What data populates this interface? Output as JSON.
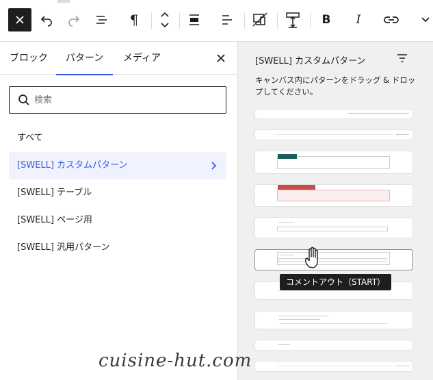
{
  "toolbar": {
    "close_icon": "close-icon",
    "undo_icon": "undo-icon",
    "redo_icon": "redo-icon",
    "list_view_icon": "list-view-icon",
    "paragraph_symbol": "¶",
    "bold_label": "B",
    "italic_label": "I",
    "more_icon": "chevron-down-icon"
  },
  "inserter": {
    "tabs": [
      "ブロック",
      "パターン",
      "メディア"
    ],
    "active_tab": "パターン",
    "search_placeholder": "検索",
    "categories": [
      {
        "label": "すべて",
        "selected": false
      },
      {
        "label": "[SWELL] カスタムパターン",
        "selected": true
      },
      {
        "label": "[SWELL] テーブル",
        "selected": false
      },
      {
        "label": "[SWELL] ページ用",
        "selected": false
      },
      {
        "label": "[SWELL] 汎用パターン",
        "selected": false
      }
    ]
  },
  "preview": {
    "title": "[SWELL] カスタムパターン",
    "description": "キャンバス内にパターンをドラッグ & ドロップしてください。",
    "tooltip": "コメントアウト（START）",
    "accent_colors": {
      "teal_tag": "#1f5f5b",
      "red_tag": "#c94a4a",
      "red_bg": "#fbeeee",
      "selected": "#3858e9"
    }
  },
  "watermark": "cuisine-hut.com"
}
